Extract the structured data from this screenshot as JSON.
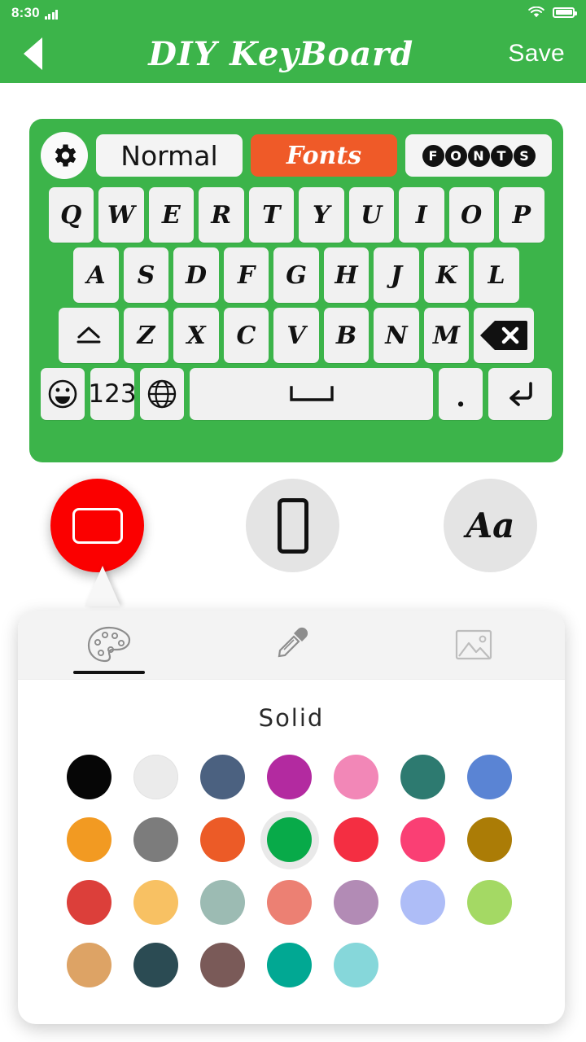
{
  "theme": {
    "brand_color": "#3cb44a",
    "accent_color": "#ef5a28",
    "selected_option_color": "#fb0000"
  },
  "status_bar": {
    "time": "8:30",
    "signal_icon": "signal-bars-icon",
    "wifi_icon": "wifi-icon",
    "battery_icon": "battery-icon"
  },
  "app_bar": {
    "back_icon": "back-arrow-icon",
    "title": "DIY KeyBoard",
    "save_label": "Save"
  },
  "keyboard": {
    "settings_icon": "gear-icon",
    "tabs": [
      {
        "label": "Normal",
        "style": "plain",
        "active": false
      },
      {
        "label": "Fonts",
        "style": "script",
        "active": true
      },
      {
        "label": "FONTS",
        "style": "bubble",
        "active": false
      }
    ],
    "bubble_letters": [
      "F",
      "O",
      "N",
      "T",
      "S"
    ],
    "row1": [
      "Q",
      "W",
      "E",
      "R",
      "T",
      "Y",
      "U",
      "I",
      "O",
      "P"
    ],
    "row2": [
      "A",
      "S",
      "D",
      "F",
      "G",
      "H",
      "J",
      "K",
      "L"
    ],
    "row3_letters": [
      "Z",
      "X",
      "C",
      "V",
      "B",
      "N",
      "M"
    ],
    "shift_icon": "shift-up-icon",
    "backspace_icon": "backspace-delete-icon",
    "emoji_label": "emoji-smiley-icon",
    "numbers_label": "123",
    "globe_icon": "globe-language-icon",
    "space_label": "space-bar-icon",
    "period_label": ".",
    "enter_icon": "enter-return-icon"
  },
  "style_options": [
    {
      "name": "background",
      "icon": "keyboard-background-icon",
      "selected": true
    },
    {
      "name": "key",
      "icon": "key-shape-icon",
      "selected": false
    },
    {
      "name": "font",
      "icon": "font-aa-icon",
      "label": "Aa",
      "selected": false
    }
  ],
  "color_panel": {
    "tabs": [
      {
        "name": "palette",
        "icon": "palette-icon",
        "active": true
      },
      {
        "name": "eyedropper",
        "icon": "eyedropper-icon",
        "active": false
      },
      {
        "name": "gallery",
        "icon": "image-gallery-icon",
        "active": false
      }
    ],
    "title": "Solid",
    "rows": [
      [
        "#060606",
        "#ebebeb",
        "#4b6180",
        "#b32aa0",
        "#f287b7",
        "#2d7a70",
        "#5a84d4"
      ],
      [
        "#f29a22",
        "#7c7c7c",
        "#ec5b27",
        "#08aa49",
        "#f42e42",
        "#fa3f74",
        "#ab7c06"
      ],
      [
        "#dc3f3a",
        "#f8c163",
        "#9cbbb3",
        "#ec8073",
        "#b28bb5",
        "#aebdf7",
        "#a4d964"
      ],
      [
        "#dda365",
        "#2b4b53",
        "#7a5a58",
        "#01a893",
        "#86d7da"
      ]
    ],
    "selected": {
      "row": 1,
      "index": 3,
      "color": "#08aa49"
    }
  }
}
